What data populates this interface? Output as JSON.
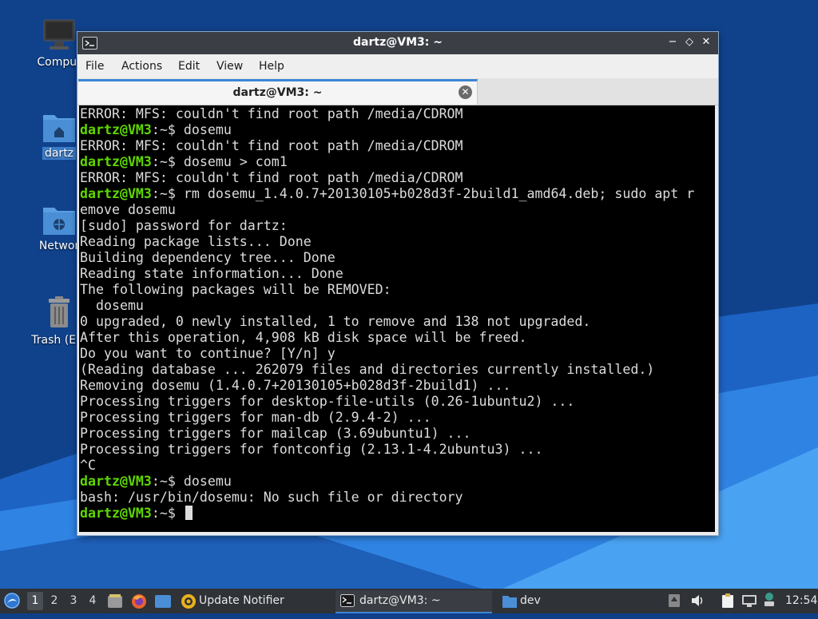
{
  "desktop": {
    "icons": [
      {
        "label": "Comput"
      },
      {
        "label": "dartz"
      },
      {
        "label": "Networ"
      },
      {
        "label": "Trash (Em"
      }
    ]
  },
  "window": {
    "title": "dartz@VM3: ~",
    "controls": {
      "minimize": "−",
      "maximize": "◇",
      "close": "✕"
    },
    "menu": [
      "File",
      "Actions",
      "Edit",
      "View",
      "Help"
    ],
    "tab": {
      "label": "dartz@VM3: ~",
      "close": "✕"
    }
  },
  "terminal": {
    "prompt_user": "dartz@VM3",
    "prompt_suffix": ":~$ ",
    "lines": [
      {
        "text": "ERROR: MFS: couldn't find root path /media/CDROM"
      },
      {
        "prompt": true,
        "text": "dosemu"
      },
      {
        "text": "ERROR: MFS: couldn't find root path /media/CDROM"
      },
      {
        "prompt": true,
        "text": "dosemu > com1"
      },
      {
        "text": "ERROR: MFS: couldn't find root path /media/CDROM"
      },
      {
        "prompt": true,
        "text": "rm dosemu_1.4.0.7+20130105+b028d3f-2build1_amd64.deb; sudo apt r"
      },
      {
        "text": "emove dosemu"
      },
      {
        "text": "[sudo] password for dartz:"
      },
      {
        "text": "Reading package lists... Done"
      },
      {
        "text": "Building dependency tree... Done"
      },
      {
        "text": "Reading state information... Done"
      },
      {
        "text": "The following packages will be REMOVED:"
      },
      {
        "text": "  dosemu"
      },
      {
        "text": "0 upgraded, 0 newly installed, 1 to remove and 138 not upgraded."
      },
      {
        "text": "After this operation, 4,908 kB disk space will be freed."
      },
      {
        "text": "Do you want to continue? [Y/n] y"
      },
      {
        "text": "(Reading database ... 262079 files and directories currently installed.)"
      },
      {
        "text": "Removing dosemu (1.4.0.7+20130105+b028d3f-2build1) ..."
      },
      {
        "text": "Processing triggers for desktop-file-utils (0.26-1ubuntu2) ..."
      },
      {
        "text": "Processing triggers for man-db (2.9.4-2) ..."
      },
      {
        "text": "Processing triggers for mailcap (3.69ubuntu1) ..."
      },
      {
        "text": "Processing triggers for fontconfig (2.13.1-4.2ubuntu3) ..."
      },
      {
        "text": "^C"
      },
      {
        "prompt": true,
        "text": "dosemu"
      },
      {
        "text": "bash: /usr/bin/dosemu: No such file or directory"
      },
      {
        "prompt": true,
        "text": "",
        "cursor": true
      }
    ]
  },
  "taskbar": {
    "workspaces": [
      "1",
      "2",
      "3",
      "4"
    ],
    "active_workspace": "1",
    "tasks": [
      {
        "label": "Update Notifier"
      },
      {
        "label": "dartz@VM3: ~"
      },
      {
        "label": "dev"
      }
    ],
    "clock": "12:54"
  },
  "colors": {
    "prompt": "#5fd700",
    "terminal_bg": "#000000",
    "terminal_fg": "#dcdcdc",
    "titlebar": "#3b3f45",
    "accent": "#3d86d6",
    "taskbar": "#2f3237"
  }
}
